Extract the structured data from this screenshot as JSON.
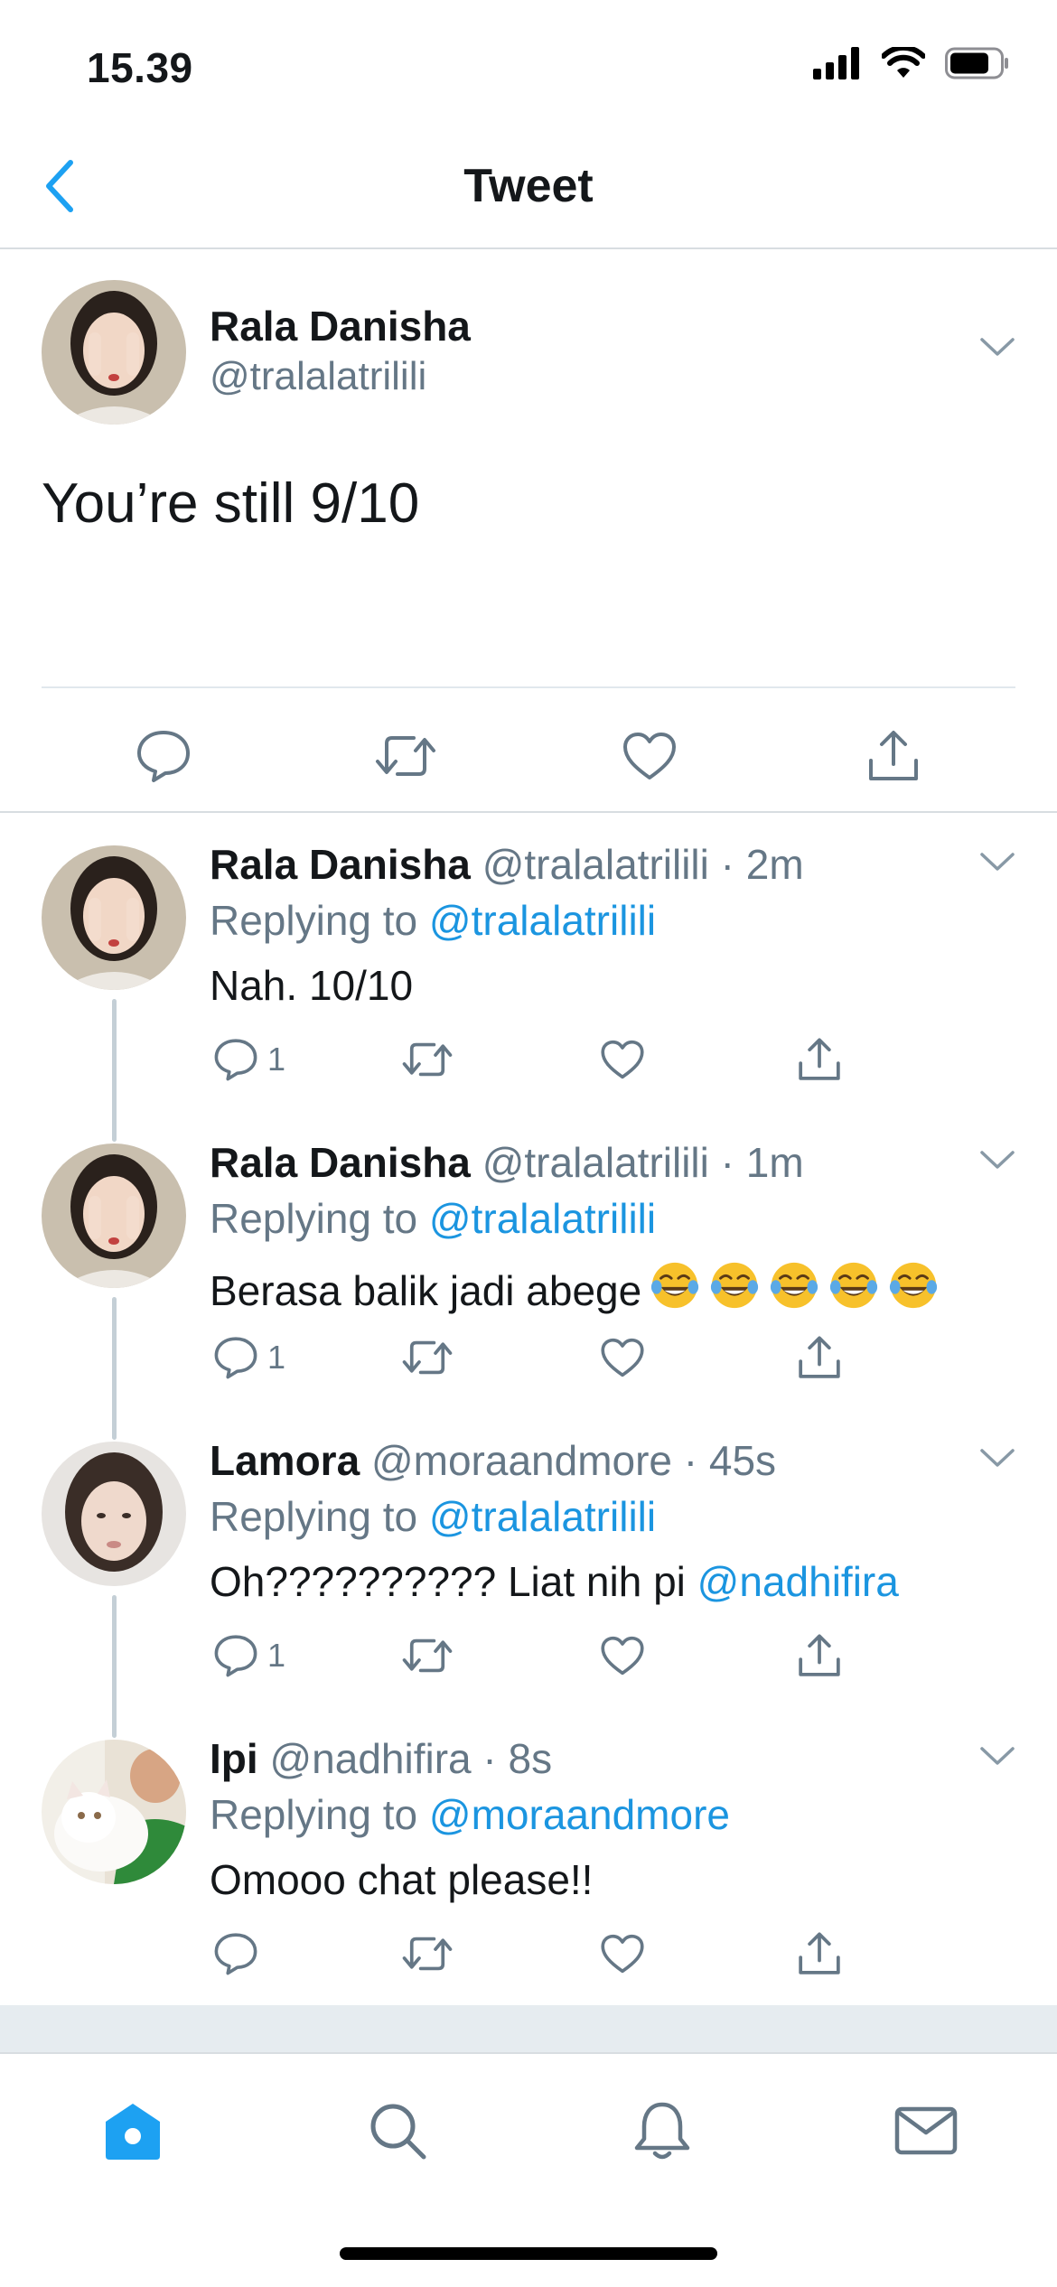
{
  "status_bar": {
    "time": "15.39"
  },
  "nav": {
    "title": "Tweet"
  },
  "main_tweet": {
    "name": "Rala Danisha",
    "handle": "@tralalatrilili",
    "text": "You’re still 9/10"
  },
  "replies": [
    {
      "name": "Rala Danisha",
      "meta": "@tralalatrilili · 2m",
      "replying_label": "Replying to",
      "replying_to": "@tralalatrilili",
      "text": "Nah. 10/10",
      "mention": "",
      "reply_count": "1",
      "emoji_count": 0
    },
    {
      "name": "Rala Danisha",
      "meta": "@tralalatrilili · 1m",
      "replying_label": "Replying to",
      "replying_to": "@tralalatrilili",
      "text": "Berasa balik jadi abege",
      "mention": "",
      "reply_count": "1",
      "emoji_count": 5
    },
    {
      "name": "Lamora",
      "meta": "@moraandmore · 45s",
      "replying_label": "Replying to",
      "replying_to": "@tralalatrilili",
      "text": "Oh?????????? Liat nih pi ",
      "mention": "@nadhifira",
      "reply_count": "1",
      "emoji_count": 0
    },
    {
      "name": "Ipi",
      "meta": "@nadhifira · 8s",
      "replying_label": "Replying to",
      "replying_to": "@moraandmore",
      "text": "Omooo chat please!!",
      "mention": "",
      "reply_count": "",
      "emoji_count": 0
    }
  ],
  "tabs": [
    "home-icon",
    "search-icon",
    "bell-icon",
    "mail-icon"
  ],
  "colors": {
    "accent": "#1da1f2",
    "link": "#1b95e0",
    "muted": "#657786",
    "icon": "#657786"
  }
}
